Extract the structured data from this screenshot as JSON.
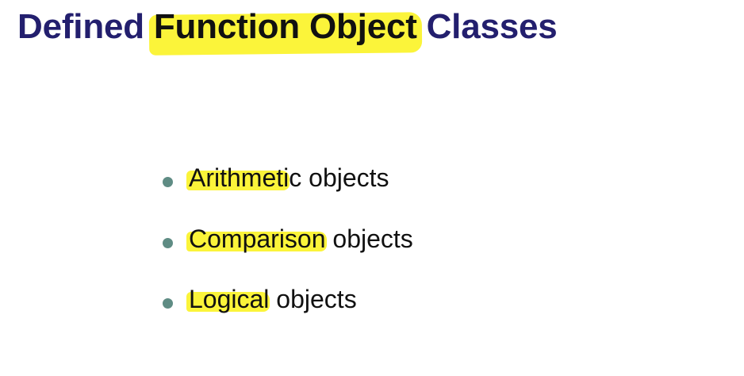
{
  "title": {
    "part_before": "Defined",
    "highlighted": "Function Object",
    "part_after": "Classes"
  },
  "bullets": [
    {
      "highlighted": "Arithmeti",
      "rest": "c objects"
    },
    {
      "highlighted": "Comparison",
      "rest": " objects"
    },
    {
      "highlighted": "Logical",
      "rest": " objects"
    }
  ],
  "colors": {
    "title": "#231f6e",
    "text": "#111111",
    "highlight": "#fbf43a",
    "bullet": "#5f8c84",
    "background": "#ffffff"
  }
}
